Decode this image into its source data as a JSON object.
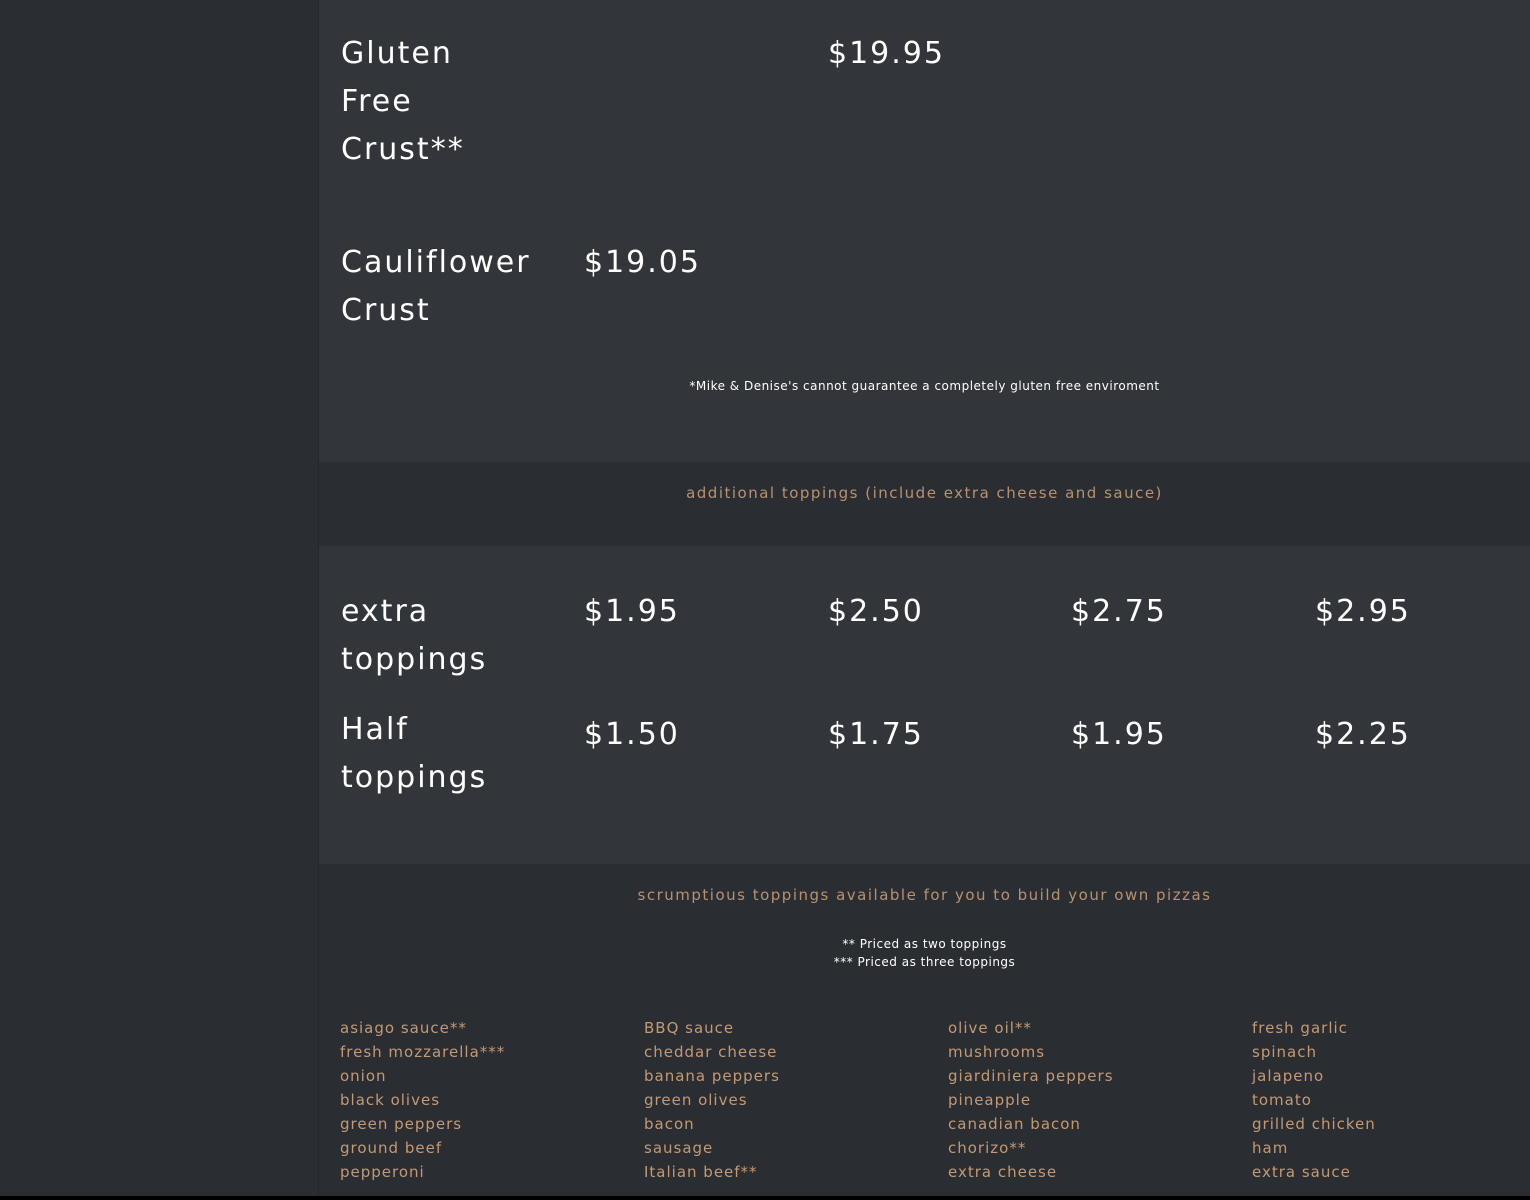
{
  "crust_items": [
    {
      "name_lines": [
        "Gluten",
        "Free",
        "Crust**"
      ],
      "price": "$19.95"
    },
    {
      "name_lines": [
        "Cauliflower",
        "Crust"
      ],
      "price": "$19.05"
    }
  ],
  "gluten_note": "*Mike & Denise's cannot guarantee a completely gluten free enviroment",
  "additional_toppings": {
    "title": "additional toppings (include extra cheese and sauce)",
    "rows": [
      {
        "name_lines": [
          "extra",
          "toppings"
        ],
        "prices": [
          "$1.95",
          "$2.50",
          "$2.75",
          "$2.95"
        ]
      },
      {
        "name_lines": [
          "Half",
          "toppings"
        ],
        "prices": [
          "$1.50",
          "$1.75",
          "$1.95",
          "$2.25"
        ]
      }
    ]
  },
  "build_your_own": {
    "title": "scrumptious toppings available for you to build your own pizzas",
    "legend": [
      "** Priced as two toppings",
      "*** Priced as three toppings"
    ],
    "columns": [
      [
        "asiago sauce**",
        "fresh mozzarella***",
        "onion",
        "black olives",
        "green peppers",
        "ground beef",
        "pepperoni"
      ],
      [
        "BBQ sauce",
        "cheddar cheese",
        "banana peppers",
        "green olives",
        "bacon",
        "sausage",
        "Italian beef**"
      ],
      [
        "olive oil**",
        "mushrooms",
        "giardiniera peppers",
        "pineapple",
        "canadian bacon",
        "chorizo**",
        "extra cheese"
      ],
      [
        "fresh garlic",
        "spinach",
        "jalapeno",
        "tomato",
        "grilled chicken",
        "ham",
        "extra sauce"
      ]
    ]
  },
  "colors": {
    "background": "#2a2d32",
    "panel": "#323539",
    "accent": "#c49a74",
    "text": "#ffffff"
  }
}
